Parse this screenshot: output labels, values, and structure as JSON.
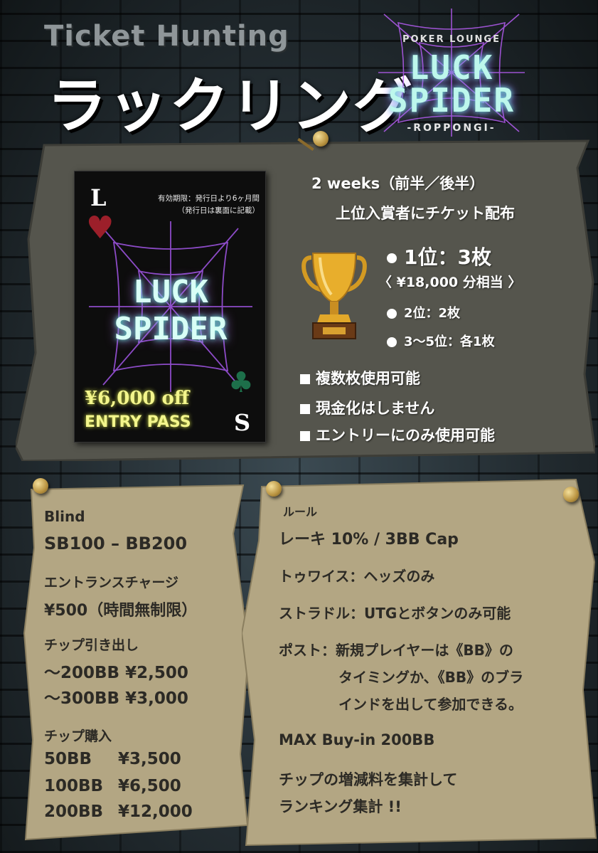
{
  "header": {
    "subtitle": "Ticket Hunting",
    "title": "ラックリング"
  },
  "logo": {
    "tagline": "POKER LOUNGE",
    "line1": "LUCK",
    "line2": "SPIDER",
    "location": "-ROPPONGI-"
  },
  "ticket": {
    "corner_top": "L",
    "corner_bottom": "S",
    "validity_line1": "有効期限：発行日より6ヶ月間",
    "validity_line2": "（発行日は裏面に記載）",
    "logo_line1": "LUCK",
    "logo_line2": "SPIDER",
    "discount": "¥6,000 off",
    "pass": "ENTRY PASS"
  },
  "event": {
    "period": "2 weeks（前半／後半）",
    "distribution": "上位入賞者にチケット配布"
  },
  "prizes": {
    "first": "1位：3枚",
    "first_value": "〈 ¥18,000 分相当 〉",
    "second": "2位：2枚",
    "third": "3～5位：各1枚"
  },
  "notes": [
    "複数枚使用可能",
    "現金化はしません",
    "エントリーにのみ使用可能"
  ],
  "left_card": {
    "blind_label": "Blind",
    "blind_value": "SB100 – BB200",
    "entrance_label": "エントランスチャージ",
    "entrance_value": "¥500（時間無制限）",
    "withdraw_label": "チップ引き出し",
    "withdraw_1": "～200BB ¥2,500",
    "withdraw_2": "～300BB ¥3,000",
    "purchase_label": "チップ購入",
    "purchase": [
      {
        "bb": "50BB",
        "price": "¥3,500"
      },
      {
        "bb": "100BB",
        "price": "¥6,500"
      },
      {
        "bb": "200BB",
        "price": "¥12,000"
      }
    ]
  },
  "right_card": {
    "rules_label": "ルール",
    "rake": "レーキ 10% / 3BB Cap",
    "twice": "トゥワイス：ヘッズのみ",
    "straddle": "ストラドル：UTGとボタンのみ可能",
    "post_1": "ポスト：新規プレイヤーは《BB》の",
    "post_2": "タイミングか、《BB》のブラ",
    "post_3": "インドを出して参加できる。",
    "max_buyin": "MAX Buy-in 200BB",
    "ranking_1": "チップの増減料を集計して",
    "ranking_2": "ランキング集計 !!"
  },
  "colors": {
    "paper_dark": "#55554d",
    "paper_light": "#b3a683",
    "text_dark": "#2c2a25",
    "neon": "#bdf7ec"
  }
}
